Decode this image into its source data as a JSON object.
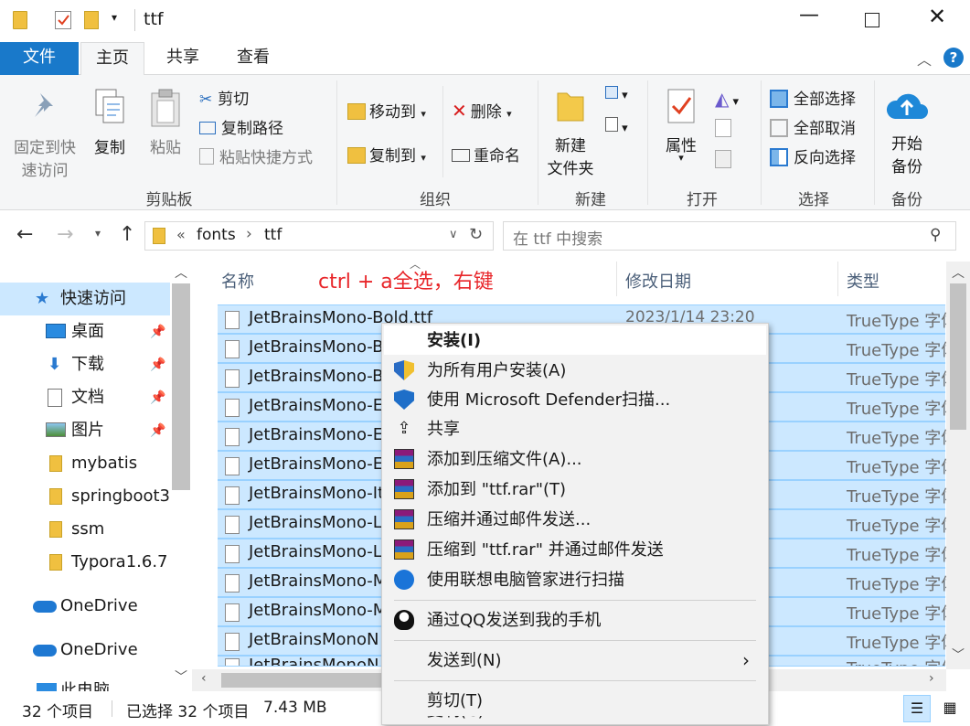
{
  "window": {
    "title": "ttf"
  },
  "ribbon_tabs": {
    "file": "文件",
    "home": "主页",
    "share": "共享",
    "view": "查看"
  },
  "ribbon": {
    "clipboard": {
      "pin_line1": "固定到快",
      "pin_line2": "速访问",
      "copy": "复制",
      "paste": "粘贴",
      "cut": "剪切",
      "copy_path": "复制路径",
      "paste_shortcut": "粘贴快捷方式",
      "group": "剪贴板"
    },
    "organize": {
      "move_to": "移动到",
      "copy_to": "复制到",
      "delete": "删除",
      "rename": "重命名",
      "group": "组织"
    },
    "new": {
      "new_line1": "新建",
      "new_line2": "文件夹",
      "group": "新建"
    },
    "open": {
      "properties": "属性",
      "group": "打开"
    },
    "select": {
      "select_all": "全部选择",
      "select_none": "全部取消",
      "invert": "反向选择",
      "group": "选择"
    },
    "backup": {
      "start_line1": "开始",
      "start_line2": "备份",
      "group": "备份"
    }
  },
  "address": {
    "chevron": "«",
    "crumb1": "fonts",
    "arrow": "›",
    "crumb2": "ttf",
    "search_placeholder": "在 ttf 中搜索"
  },
  "nav": {
    "items": [
      {
        "label": "快速访问"
      },
      {
        "label": "桌面"
      },
      {
        "label": "下载"
      },
      {
        "label": "文档"
      },
      {
        "label": "图片"
      },
      {
        "label": "mybatis"
      },
      {
        "label": "springboot3"
      },
      {
        "label": "ssm"
      },
      {
        "label": "Typora1.6.7"
      },
      {
        "label": "OneDrive"
      },
      {
        "label": "OneDrive"
      },
      {
        "label": "此电脑"
      }
    ]
  },
  "columns": {
    "name": "名称",
    "modified": "修改日期",
    "type": "类型"
  },
  "annotation": "ctrl + a全选，右键",
  "files": [
    {
      "name": "JetBrainsMono-Bold.ttf",
      "date": "2023/1/14 23:20",
      "type": "TrueType 字体"
    },
    {
      "name": "JetBrainsMono-B",
      "type": "TrueType 字体"
    },
    {
      "name": "JetBrainsMono-B",
      "type": "TrueType 字体"
    },
    {
      "name": "JetBrainsMono-E",
      "type": "TrueType 字体"
    },
    {
      "name": "JetBrainsMono-E",
      "type": "TrueType 字体"
    },
    {
      "name": "JetBrainsMono-E",
      "type": "TrueType 字体"
    },
    {
      "name": "JetBrainsMono-It",
      "type": "TrueType 字体"
    },
    {
      "name": "JetBrainsMono-L",
      "type": "TrueType 字体"
    },
    {
      "name": "JetBrainsMono-L",
      "type": "TrueType 字体"
    },
    {
      "name": "JetBrainsMono-M",
      "type": "TrueType 字体"
    },
    {
      "name": "JetBrainsMono-M",
      "type": "TrueType 字体"
    },
    {
      "name": "JetBrainsMonoN",
      "type": "TrueType 字体"
    },
    {
      "name": "JetBrainsMonoN",
      "type": "TrueType 字体"
    }
  ],
  "context_menu": {
    "items": [
      {
        "label": "安装(I)"
      },
      {
        "label": "为所有用户安装(A)"
      },
      {
        "label": "使用 Microsoft Defender扫描..."
      },
      {
        "label": "共享"
      },
      {
        "label": "添加到压缩文件(A)..."
      },
      {
        "label": "添加到 \"ttf.rar\"(T)"
      },
      {
        "label": "压缩并通过邮件发送..."
      },
      {
        "label": "压缩到 \"ttf.rar\" 并通过邮件发送"
      },
      {
        "label": "使用联想电脑管家进行扫描"
      },
      {
        "label": "通过QQ发送到我的手机"
      },
      {
        "label": "发送到(N)"
      },
      {
        "label": "剪切(T)"
      },
      {
        "label": "复制(C)"
      }
    ]
  },
  "status": {
    "count": "32 个项目",
    "selected": "已选择 32 个项目",
    "size": "7.43 MB"
  },
  "colors": {
    "accent": "#1979ca",
    "selection": "#cce8ff",
    "annotation": "#e8262a"
  }
}
